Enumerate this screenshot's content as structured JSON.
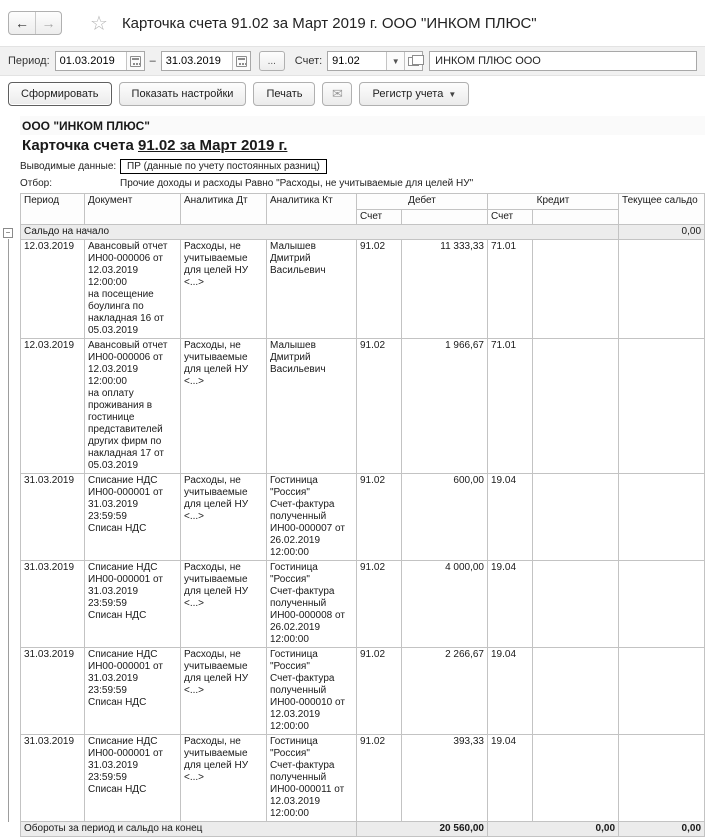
{
  "window": {
    "back": "←",
    "forward": "→",
    "star": "☆",
    "title": "Карточка счета 91.02 за Март 2019 г. ООО \"ИНКОМ ПЛЮС\""
  },
  "filters": {
    "period_label": "Период:",
    "period_from": "01.03.2019",
    "dash": "–",
    "period_to": "31.03.2019",
    "period_picker": "...",
    "account_label": "Счет:",
    "account": "91.02",
    "dropdown_arrow": "▼",
    "organization": "ИНКОМ ПЛЮС ООО"
  },
  "toolbar": {
    "generate": "Сформировать",
    "settings": "Показать настройки",
    "print": "Печать",
    "mail_icon": "✉",
    "register": "Регистр учета",
    "register_arrow": "▼"
  },
  "report": {
    "organization": "ООО \"ИНКОМ ПЛЮС\"",
    "title_prefix": "Карточка счета ",
    "title_underlined": "91.02 за Март 2019 г.",
    "output_label": "Выводимые данные:",
    "output_value": "ПР (данные по учету постоянных разниц)",
    "filter_label": "Отбор:",
    "filter_value": "Прочие доходы и расходы Равно \"Расходы, не учитываемые для целей НУ\""
  },
  "table": {
    "headers": {
      "period": "Период",
      "document": "Документ",
      "analytics_dt": "Аналитика Дт",
      "analytics_kt": "Аналитика Кт",
      "debit": "Дебет",
      "credit": "Кредит",
      "balance": "Текущее сальдо",
      "account": "Счет"
    },
    "expander": "−",
    "saldo_row": {
      "label": "Сальдо на начало",
      "balance": "0,00"
    },
    "rows": [
      {
        "period": "12.03.2019",
        "document": "Авансовый отчет ИН00-000006 от 12.03.2019 12:00:00\nна посещение боулинга  по накладная 16 от 05.03.2019",
        "analytics_dt": "Расходы, не учитываемые для целей НУ\n<...>",
        "analytics_kt": "Малышев Дмитрий Васильевич",
        "debit_account": "91.02",
        "debit": "11 333,33",
        "credit_account": "71.01",
        "credit": "",
        "balance": ""
      },
      {
        "period": "12.03.2019",
        "document": "Авансовый отчет ИН00-000006 от 12.03.2019 12:00:00\nна оплату проживания в гостинице представителей других фирм  по накладная 17 от 05.03.2019",
        "analytics_dt": "Расходы, не учитываемые для целей НУ\n<...>",
        "analytics_kt": "Малышев Дмитрий Васильевич",
        "debit_account": "91.02",
        "debit": "1 966,67",
        "credit_account": "71.01",
        "credit": "",
        "balance": ""
      },
      {
        "period": "31.03.2019",
        "document": "Списание НДС ИН00-000001 от 31.03.2019 23:59:59\nСписан НДС",
        "analytics_dt": "Расходы, не учитываемые для целей НУ\n<...>",
        "analytics_kt": "Гостиница \"Россия\"\nСчет-фактура полученный ИН00-000007 от 26.02.2019 12:00:00",
        "debit_account": "91.02",
        "debit": "600,00",
        "credit_account": "19.04",
        "credit": "",
        "balance": ""
      },
      {
        "period": "31.03.2019",
        "document": "Списание НДС ИН00-000001 от 31.03.2019 23:59:59\nСписан НДС",
        "analytics_dt": "Расходы, не учитываемые для целей НУ\n<...>",
        "analytics_kt": "Гостиница \"Россия\"\nСчет-фактура полученный ИН00-000008 от 26.02.2019 12:00:00",
        "debit_account": "91.02",
        "debit": "4 000,00",
        "credit_account": "19.04",
        "credit": "",
        "balance": ""
      },
      {
        "period": "31.03.2019",
        "document": "Списание НДС ИН00-000001 от 31.03.2019 23:59:59\nСписан НДС",
        "analytics_dt": "Расходы, не учитываемые для целей НУ\n<...>",
        "analytics_kt": "Гостиница \"Россия\"\nСчет-фактура полученный ИН00-000010 от 12.03.2019 12:00:00",
        "debit_account": "91.02",
        "debit": "2 266,67",
        "credit_account": "19.04",
        "credit": "",
        "balance": ""
      },
      {
        "period": "31.03.2019",
        "document": "Списание НДС ИН00-000001 от 31.03.2019 23:59:59\nСписан НДС",
        "analytics_dt": "Расходы, не учитываемые для целей НУ\n<...>",
        "analytics_kt": "Гостиница \"Россия\"\nСчет-фактура полученный ИН00-000011 от 12.03.2019 12:00:00",
        "debit_account": "91.02",
        "debit": "393,33",
        "credit_account": "19.04",
        "credit": "",
        "balance": ""
      }
    ],
    "footer": {
      "label": "Обороты за период и сальдо на конец",
      "debit": "20 560,00",
      "credit": "0,00",
      "balance": "0,00"
    }
  }
}
